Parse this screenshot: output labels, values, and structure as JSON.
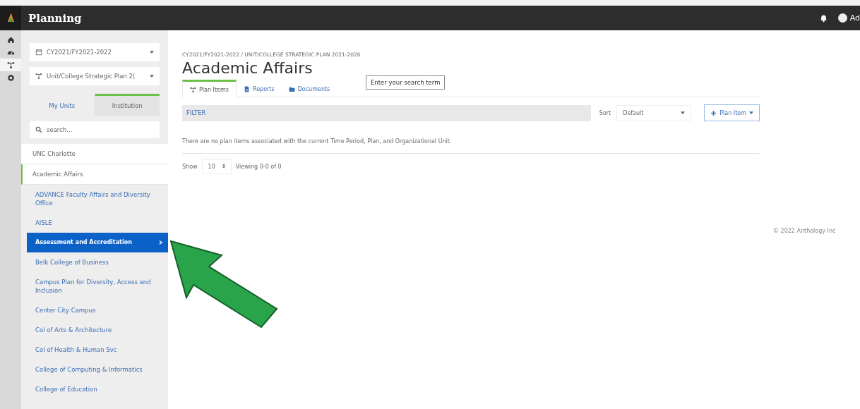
{
  "topbar": {
    "title": "Planning",
    "user": "Ad"
  },
  "rail": {
    "items": [
      {
        "selected": false
      },
      {
        "selected": false
      },
      {
        "selected": true
      },
      {
        "selected": false
      }
    ]
  },
  "sidebar": {
    "period": "CY2021/FY2021-2022",
    "plan": "Unit/College Strategic Plan 2(",
    "tabs": [
      {
        "label": "My Units",
        "selected": false
      },
      {
        "label": "Institution",
        "selected": true
      }
    ],
    "search": {
      "placeholder": "search..."
    },
    "items": [
      {
        "label": "UNC Charlotte",
        "kind": "parent",
        "selected": false
      },
      {
        "label": "Academic Affairs",
        "kind": "current",
        "selected": false
      },
      {
        "label": "ADVANCE Faculty Affairs and Diversity Office",
        "kind": "child",
        "selected": false
      },
      {
        "label": "AISLE",
        "kind": "child",
        "selected": false
      },
      {
        "label": "Assessment and Accreditation",
        "kind": "child",
        "selected": true
      },
      {
        "label": "Belk College of Business",
        "kind": "child",
        "selected": false
      },
      {
        "label": "Campus Plan for Diversity, Access and Inclusion",
        "kind": "child",
        "selected": false
      },
      {
        "label": "Center City Campus",
        "kind": "child",
        "selected": false
      },
      {
        "label": "Col of Arts & Architecture",
        "kind": "child",
        "selected": false
      },
      {
        "label": "Col of Health & Human Svc",
        "kind": "child",
        "selected": false
      },
      {
        "label": "College of Computing & Informatics",
        "kind": "child",
        "selected": false
      },
      {
        "label": "College of Education",
        "kind": "child",
        "selected": false
      }
    ]
  },
  "main": {
    "breadcrumb": "CY2021/FY2021-2022 / UNIT/COLLEGE STRATEGIC PLAN 2021-2026",
    "title": "Academic Affairs",
    "tabs": [
      {
        "label": "Plan Items",
        "selected": true
      },
      {
        "label": "Reports",
        "selected": false
      },
      {
        "label": "Documents",
        "selected": false
      }
    ],
    "tooltip": "Enter your search term",
    "filter": "FILTER",
    "sort_label": "Sort",
    "sort_value": "Default",
    "add_button": "Plan Item",
    "empty_message": "There are no plan items associated with the current Time Period, Plan, and Organizational Unit.",
    "show_label": "Show",
    "page_size": "10",
    "viewing": "Viewing 0-0 of 0"
  },
  "footer": {
    "copyright": "© 2022 Anthology Inc"
  }
}
